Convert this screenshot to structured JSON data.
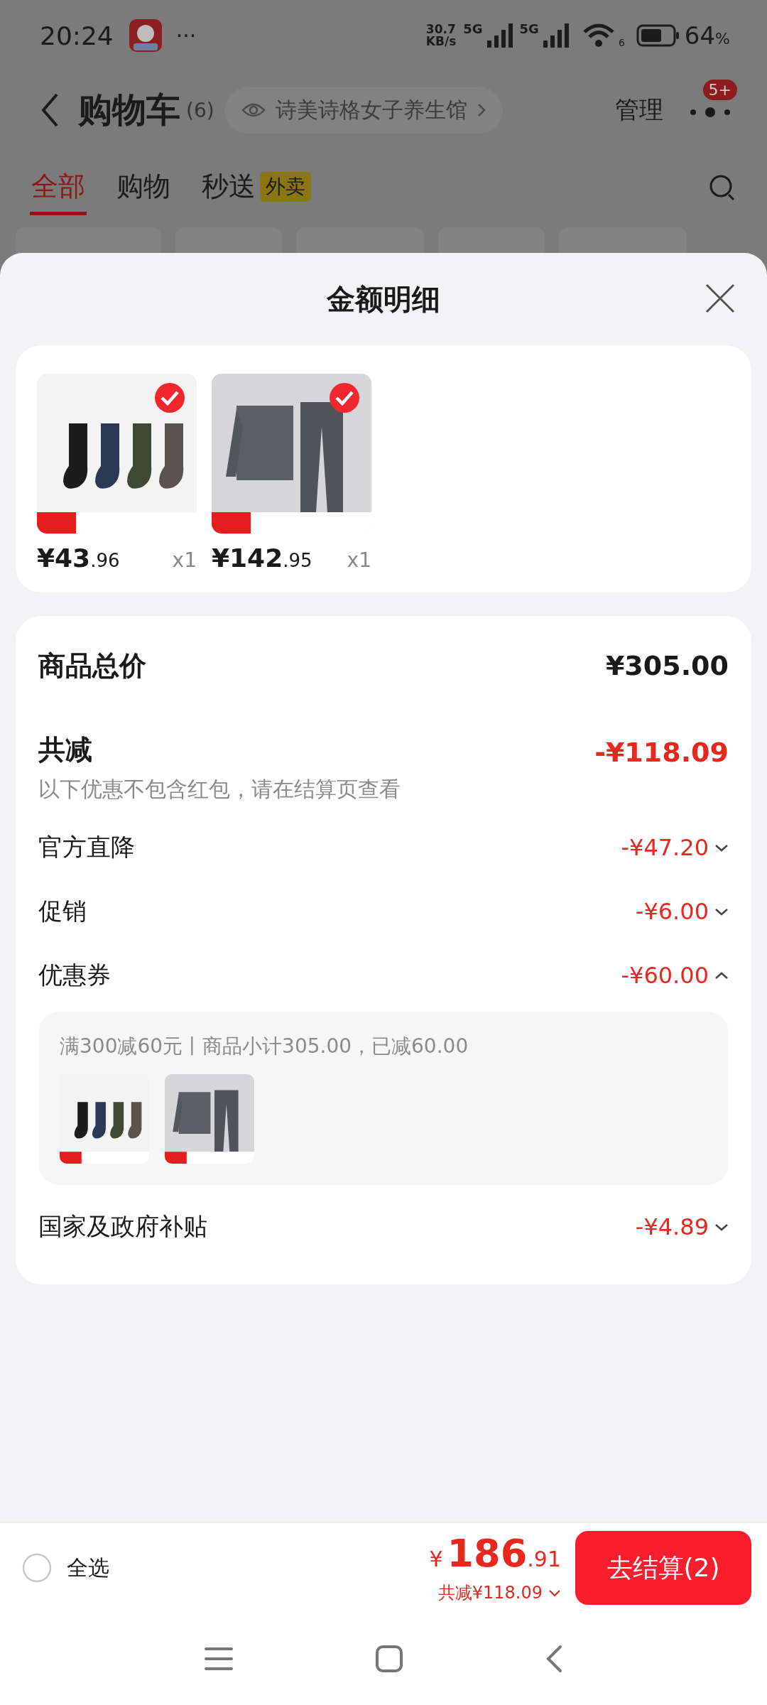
{
  "status_bar": {
    "time": "20:24",
    "dots": "···",
    "speed_value": "30.7",
    "speed_unit": "KB/s",
    "sim_1": "5G",
    "sim_2": "5G",
    "wifi_label": "6",
    "battery": "64",
    "battery_unit": "%"
  },
  "header": {
    "title": "购物车",
    "count": "(6)",
    "store": "诗美诗格女子养生馆",
    "manage": "管理",
    "badge": "5+"
  },
  "tabs": [
    {
      "label": "全部",
      "selected": true
    },
    {
      "label": "购物",
      "selected": false
    },
    {
      "label": "秒送",
      "selected": false,
      "tag": "外卖"
    }
  ],
  "sheet": {
    "title": "金额明细",
    "products": [
      {
        "kind": "picture",
        "checked": true,
        "price": "¥43",
        "price_decimal": ".96",
        "quantity": "x1"
      },
      {
        "kind": "picture",
        "checked": true,
        "price": "¥142",
        "price_decimal": ".95",
        "quantity": "x1"
      }
    ],
    "total": {
      "label": "商品总价",
      "value": "¥305.00"
    },
    "discount": {
      "label": "共减",
      "value": "-¥118.09",
      "note": "以下优惠不包含红包，请在结算页查看"
    },
    "discount_items": [
      {
        "label": "官方直降",
        "value": "-¥47.20",
        "expanded": false
      },
      {
        "label": "促销",
        "value": "-¥6.00",
        "expanded": false
      },
      {
        "label": "优惠券",
        "value": "-¥60.00",
        "expanded": true,
        "detail": "满300减60元丨商品小计305.00，已减60.00"
      },
      {
        "label": "国家及政府补贴",
        "value": "-¥4.89",
        "expanded": false
      }
    ]
  },
  "bottom_bar": {
    "select_all": {
      "label": "全选",
      "checked": false
    },
    "currency": "¥",
    "amount": "186",
    "amount_decimal": ".91",
    "saved": "共减¥118.09",
    "checkout": "去结算(2)"
  }
}
